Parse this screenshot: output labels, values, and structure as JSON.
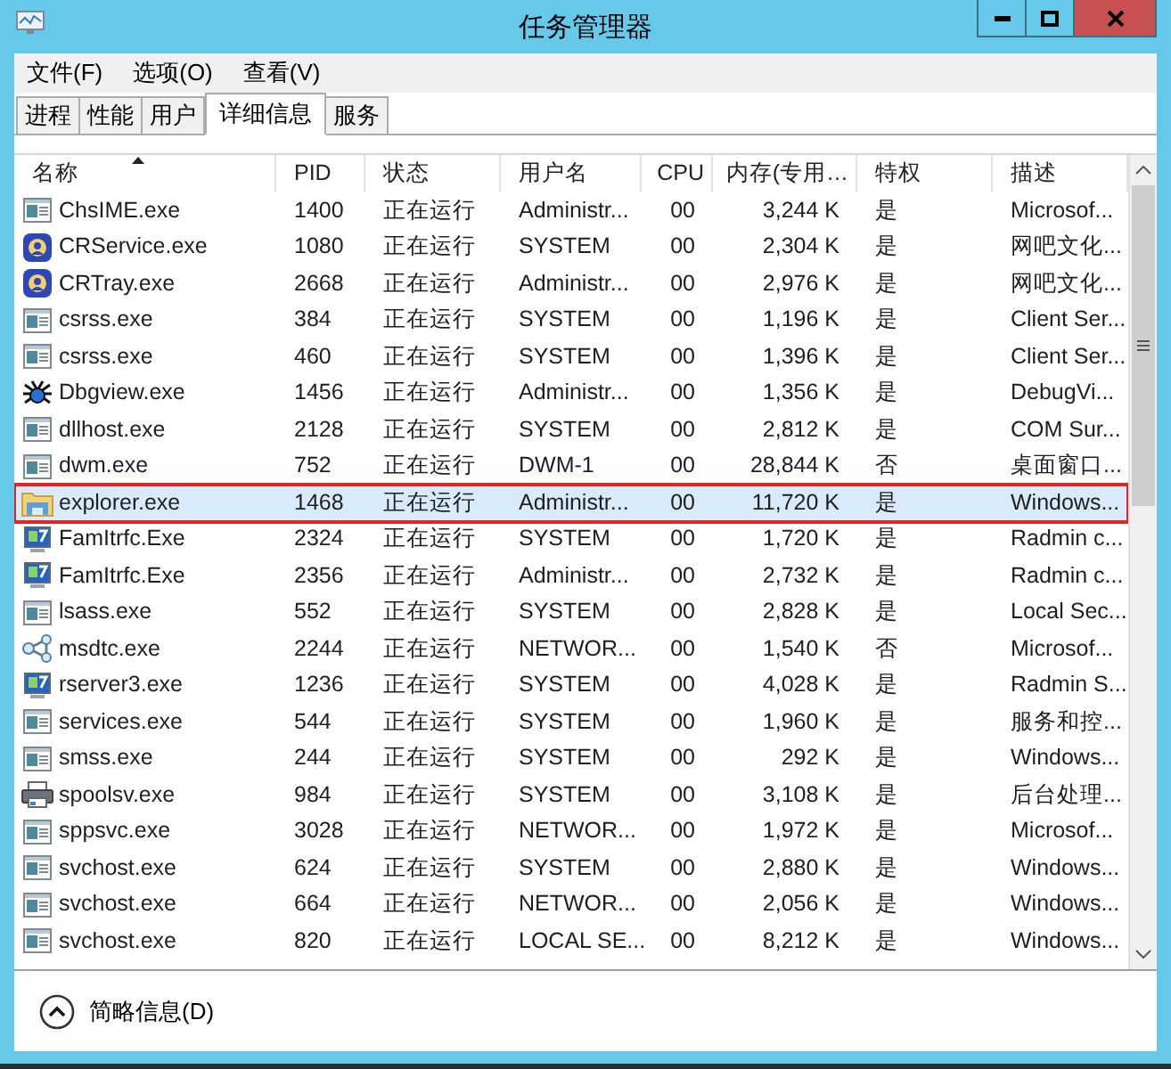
{
  "window": {
    "title": "任务管理器"
  },
  "menu": [
    "文件(F)",
    "选项(O)",
    "查看(V)"
  ],
  "tabs": [
    {
      "label": "进程",
      "selected": false
    },
    {
      "label": "性能",
      "selected": false
    },
    {
      "label": "用户",
      "selected": false
    },
    {
      "label": "详细信息",
      "selected": true
    },
    {
      "label": "服务",
      "selected": false
    }
  ],
  "table": {
    "columns": [
      {
        "label": "名称",
        "sorted": true,
        "kind": "text"
      },
      {
        "label": "PID",
        "sorted": false,
        "kind": "text"
      },
      {
        "label": "状态",
        "sorted": false,
        "kind": "text"
      },
      {
        "label": "用户名",
        "sorted": false,
        "kind": "text"
      },
      {
        "label": "CPU",
        "sorted": false,
        "kind": "number"
      },
      {
        "label": "内存(专用…",
        "sorted": false,
        "kind": "number"
      },
      {
        "label": "特权",
        "sorted": false,
        "kind": "text"
      },
      {
        "label": "描述",
        "sorted": false,
        "kind": "text"
      }
    ],
    "rows": [
      {
        "kind": "window",
        "selected": false,
        "cells": [
          "ChsIME.exe",
          "1400",
          "正在运行",
          "Administr...",
          "00",
          "3,244 K",
          "是",
          "Microsof..."
        ]
      },
      {
        "kind": "shield",
        "selected": false,
        "cells": [
          "CRService.exe",
          "1080",
          "正在运行",
          "SYSTEM",
          "00",
          "2,304 K",
          "是",
          "网吧文化..."
        ]
      },
      {
        "kind": "shield",
        "selected": false,
        "cells": [
          "CRTray.exe",
          "2668",
          "正在运行",
          "Administr...",
          "00",
          "2,976 K",
          "是",
          "网吧文化..."
        ]
      },
      {
        "kind": "window",
        "selected": false,
        "cells": [
          "csrss.exe",
          "384",
          "正在运行",
          "SYSTEM",
          "00",
          "1,196 K",
          "是",
          "Client Ser..."
        ]
      },
      {
        "kind": "window",
        "selected": false,
        "cells": [
          "csrss.exe",
          "460",
          "正在运行",
          "SYSTEM",
          "00",
          "1,396 K",
          "是",
          "Client Ser..."
        ]
      },
      {
        "kind": "bug",
        "selected": false,
        "cells": [
          "Dbgview.exe",
          "1456",
          "正在运行",
          "Administr...",
          "00",
          "1,356 K",
          "是",
          "DebugVi..."
        ]
      },
      {
        "kind": "window",
        "selected": false,
        "cells": [
          "dllhost.exe",
          "2128",
          "正在运行",
          "SYSTEM",
          "00",
          "2,812 K",
          "是",
          "COM Sur..."
        ]
      },
      {
        "kind": "window",
        "selected": false,
        "cells": [
          "dwm.exe",
          "752",
          "正在运行",
          "DWM-1",
          "00",
          "28,844 K",
          "否",
          "桌面窗口..."
        ]
      },
      {
        "kind": "folder",
        "selected": true,
        "cells": [
          "explorer.exe",
          "1468",
          "正在运行",
          "Administr...",
          "00",
          "11,720 K",
          "是",
          "Windows..."
        ]
      },
      {
        "kind": "monitor",
        "selected": false,
        "cells": [
          "FamItrfc.Exe",
          "2324",
          "正在运行",
          "SYSTEM",
          "00",
          "1,720 K",
          "是",
          "Radmin c..."
        ]
      },
      {
        "kind": "monitor",
        "selected": false,
        "cells": [
          "FamItrfc.Exe",
          "2356",
          "正在运行",
          "Administr...",
          "00",
          "2,732 K",
          "是",
          "Radmin c..."
        ]
      },
      {
        "kind": "window",
        "selected": false,
        "cells": [
          "lsass.exe",
          "552",
          "正在运行",
          "SYSTEM",
          "00",
          "2,828 K",
          "是",
          "Local Sec..."
        ]
      },
      {
        "kind": "network",
        "selected": false,
        "cells": [
          "msdtc.exe",
          "2244",
          "正在运行",
          "NETWOR...",
          "00",
          "1,540 K",
          "否",
          "Microsof..."
        ]
      },
      {
        "kind": "monitor",
        "selected": false,
        "cells": [
          "rserver3.exe",
          "1236",
          "正在运行",
          "SYSTEM",
          "00",
          "4,028 K",
          "是",
          "Radmin S..."
        ]
      },
      {
        "kind": "window",
        "selected": false,
        "cells": [
          "services.exe",
          "544",
          "正在运行",
          "SYSTEM",
          "00",
          "1,960 K",
          "是",
          "服务和控..."
        ]
      },
      {
        "kind": "window",
        "selected": false,
        "cells": [
          "smss.exe",
          "244",
          "正在运行",
          "SYSTEM",
          "00",
          "292 K",
          "是",
          "Windows..."
        ]
      },
      {
        "kind": "printer",
        "selected": false,
        "cells": [
          "spoolsv.exe",
          "984",
          "正在运行",
          "SYSTEM",
          "00",
          "3,108 K",
          "是",
          "后台处理..."
        ]
      },
      {
        "kind": "window",
        "selected": false,
        "cells": [
          "sppsvc.exe",
          "3028",
          "正在运行",
          "NETWOR...",
          "00",
          "1,972 K",
          "是",
          "Microsof..."
        ]
      },
      {
        "kind": "window",
        "selected": false,
        "cells": [
          "svchost.exe",
          "624",
          "正在运行",
          "SYSTEM",
          "00",
          "2,880 K",
          "是",
          "Windows..."
        ]
      },
      {
        "kind": "window",
        "selected": false,
        "cells": [
          "svchost.exe",
          "664",
          "正在运行",
          "NETWOR...",
          "00",
          "2,056 K",
          "是",
          "Windows..."
        ]
      },
      {
        "kind": "window",
        "selected": false,
        "cells": [
          "svchost.exe",
          "820",
          "正在运行",
          "LOCAL SE...",
          "00",
          "8,212 K",
          "是",
          "Windows..."
        ]
      }
    ]
  },
  "footer": {
    "label": "简略信息(D)"
  }
}
